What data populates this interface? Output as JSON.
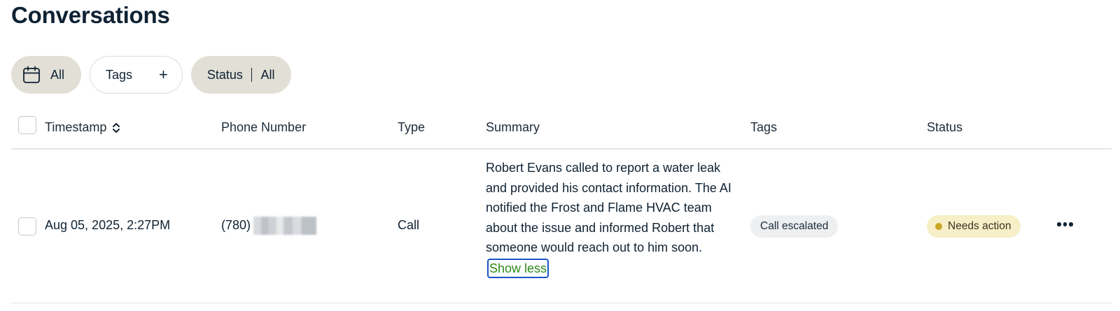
{
  "page": {
    "title": "Conversations"
  },
  "filters": {
    "date": {
      "icon": "calendar-icon",
      "label": "All"
    },
    "tags": {
      "label": "Tags",
      "icon": "plus-icon",
      "icon_glyph": "+"
    },
    "status": {
      "label": "Status",
      "value": "All"
    }
  },
  "table": {
    "columns": [
      "Timestamp",
      "Phone Number",
      "Type",
      "Summary",
      "Tags",
      "Status"
    ],
    "sort_icon": "sort-icon",
    "rows": [
      {
        "timestamp": "Aug 05, 2025, 2:27PM",
        "phone_prefix": "(780)",
        "type": "Call",
        "summary": "Robert Evans called to report a water leak and provided his contact information. The AI notified the Frost and Flame HVAC team about the issue and informed Robert that someone would reach out to him soon.",
        "show_less": "Show less",
        "tag": "Call escalated",
        "status": "Needs action",
        "status_color": "#c9a624",
        "more_icon": "more-horizontal-icon"
      }
    ]
  },
  "colors": {
    "chip_bg": "#e2dfd6",
    "link_green": "#2e8a1a",
    "focus_blue": "#1a55c8",
    "status_bg": "#f6efc7"
  }
}
